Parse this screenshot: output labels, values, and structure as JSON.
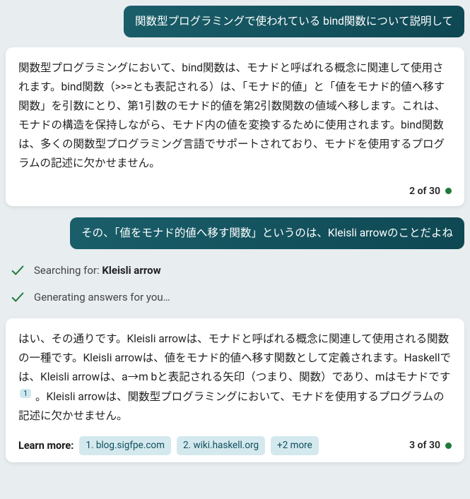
{
  "messages": {
    "user1": "関数型プログラミングで使われている bind関数について説明して",
    "bot1": "関数型プログラミングにおいて、bind関数は、モナドと呼ばれる概念に関連して使用されます。bind関数（>>=とも表記される）は、「モナド的値」と「値をモナド的値へ移す関数」を引数にとり、第1引数のモナド的値を第2引数関数の値域へ移します。これは、モナドの構造を保持しながら、モナド内の値を変換するために使用されます。bind関数は、多くの関数型プログラミング言語でサポートされており、モナドを使用するプログラムの記述に欠かせません。",
    "user2": "その、「値をモナド的値へ移す関数」というのは、Kleisli arrowのことだよね",
    "bot2_pre": "はい、その通りです。Kleisli arrowは、モナドと呼ばれる概念に関連して使用される関数の一種です。Kleisli arrowは、値をモナド的値へ移す関数として定義されます。Haskellでは、Kleisli arrowは、a→m bと表記される矢印（つまり、関数）であり、mはモナドです",
    "bot2_cite": "1",
    "bot2_post": " 。Kleisli arrowは、関数型プログラミングにおいて、モナドを使用するプログラムの記述に欠かせません。"
  },
  "status": {
    "search_prefix": "Searching for: ",
    "search_term": "Kleisli arrow",
    "generating": "Generating answers for you…"
  },
  "counter1": "2 of 30",
  "counter2": "3 of 30",
  "learn": {
    "label": "Learn more:",
    "chips": [
      "1. blog.sigfpe.com",
      "2. wiki.haskell.org",
      "+2 more"
    ]
  }
}
